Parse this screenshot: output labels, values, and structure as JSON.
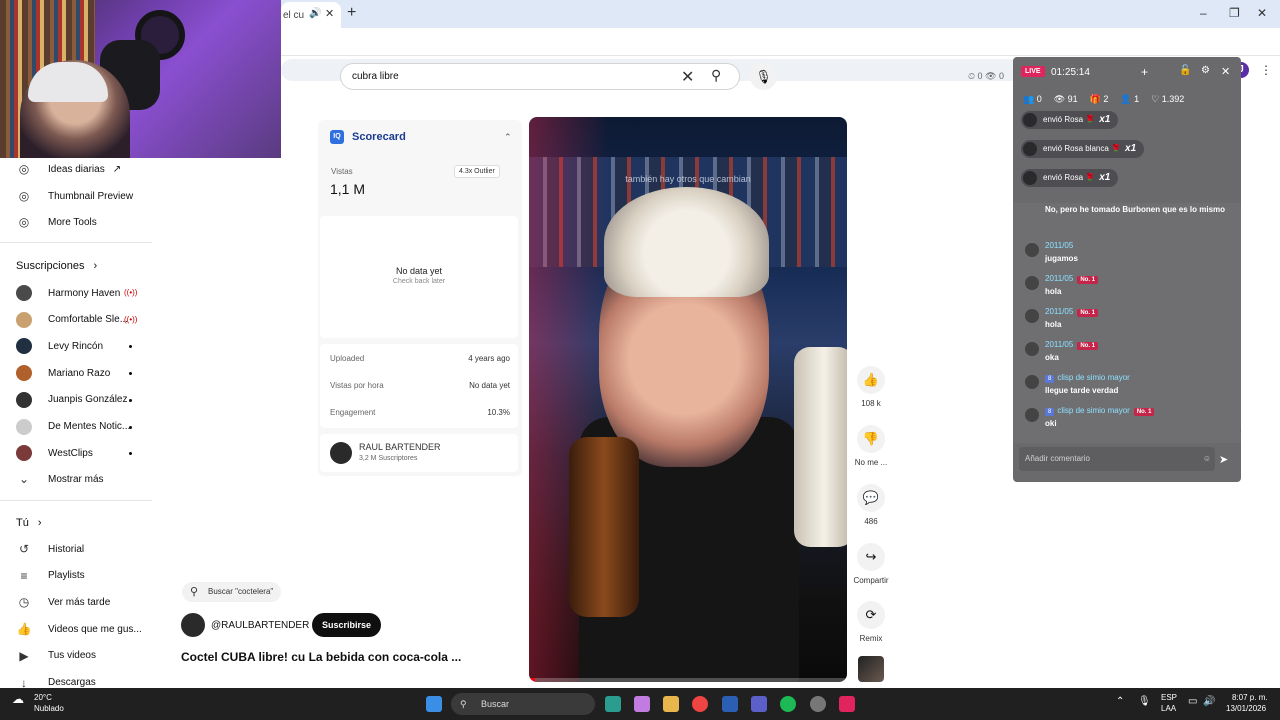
{
  "browser": {
    "tab_title": "el cu",
    "new_tab": "+",
    "win_minimize": "–",
    "win_restore": "❐",
    "win_close": "✕",
    "profile_initial": "J"
  },
  "sidebar": {
    "tools": [
      {
        "label": "Ideas diarias",
        "icon": "external-link-icon"
      },
      {
        "label": "Thumbnail Preview"
      },
      {
        "label": "More Tools"
      }
    ],
    "subscriptions_header": "Suscripciones",
    "subscriptions": [
      {
        "label": "Harmony Haven",
        "status": "live",
        "color": "#4a4a4a"
      },
      {
        "label": "Comfortable Sle...",
        "status": "live",
        "color": "#c9a070"
      },
      {
        "label": "Levy Rincón",
        "status": "new",
        "color": "#203040"
      },
      {
        "label": "Mariano Razo",
        "status": "new",
        "color": "#b0602a"
      },
      {
        "label": "Juanpis González",
        "status": "new",
        "color": "#333333"
      },
      {
        "label": "De Mentes Notic...",
        "status": "new",
        "color": "#cccccc"
      },
      {
        "label": "WestClips",
        "status": "new",
        "color": "#7a3a3a"
      }
    ],
    "show_more": "Mostrar más",
    "you_header": "Tú",
    "you_items": [
      {
        "label": "Historial",
        "icon": "history-icon"
      },
      {
        "label": "Playlists",
        "icon": "playlist-icon"
      },
      {
        "label": "Ver más tarde",
        "icon": "clock-icon"
      },
      {
        "label": "Videos que me gus...",
        "icon": "like-icon"
      },
      {
        "label": "Tus videos",
        "icon": "play-square-icon"
      },
      {
        "label": "Descargas",
        "icon": "download-icon"
      }
    ]
  },
  "search": {
    "value": "cubra libre"
  },
  "scorecard": {
    "title": "Scorecard",
    "views_label": "Vistas",
    "views_value": "1,1 M",
    "outlier": "4.3x Outlier",
    "no_data": "No data yet",
    "check_back": "Check back later",
    "rows": [
      {
        "label": "Uploaded",
        "value": "4 years ago"
      },
      {
        "label": "Vistas por hora",
        "value": "No data yet"
      },
      {
        "label": "Engagement",
        "value": "10.3%"
      }
    ],
    "channel_name": "RAUL BARTENDER",
    "channel_subs": "3,2 M Suscriptores"
  },
  "video": {
    "caption": "también hay otros que cambian",
    "progress": 0.02
  },
  "actions": [
    {
      "name": "like",
      "icon": "👍",
      "label": "108 k"
    },
    {
      "name": "dislike",
      "icon": "👎",
      "label": "No me ..."
    },
    {
      "name": "comments",
      "icon": "💬",
      "label": "486"
    },
    {
      "name": "share",
      "icon": "↪",
      "label": "Compartir"
    },
    {
      "name": "remix",
      "icon": "⟳",
      "label": "Remix"
    }
  ],
  "below_video": {
    "search_chip": "Buscar \"coctelera\"",
    "channel_handle": "@RAULBARTENDER",
    "subscribe": "Suscribirse",
    "title": "Coctel CUBA libre! cu La bebida con coca-cola ..."
  },
  "top_stats": "⏲ 0  👁 0",
  "live_panel": {
    "badge": "LIVE",
    "time": "01:25:14",
    "stats": [
      "0",
      "91",
      "2",
      "1",
      "1.392"
    ],
    "gifts": [
      {
        "text": "envió Rosa",
        "count": "x1"
      },
      {
        "text": "envió Rosa blanca",
        "count": "x1"
      },
      {
        "text": "envió Rosa",
        "count": "x1"
      }
    ],
    "messages": [
      {
        "user": "",
        "text": "No, pero he tomado Burbonen que es lo mismo"
      },
      {
        "user": "2011/05",
        "text": "jugamos",
        "badge": ""
      },
      {
        "user": "2011/05",
        "text": "hola",
        "badge": "No. 1"
      },
      {
        "user": "2011/05",
        "text": "hola",
        "badge": "No. 1"
      },
      {
        "user": "2011/05",
        "text": "oka",
        "badge": "No. 1"
      },
      {
        "user": "clisp de simio mayor",
        "text": "llegue tarde verdad",
        "level": "8"
      },
      {
        "user": "clisp de simio mayor",
        "text": "oki",
        "level": "8",
        "badge": "No. 1"
      }
    ],
    "comment_placeholder": "Añadir comentario"
  },
  "taskbar": {
    "weather_temp": "20°C",
    "weather_desc": "Nublado",
    "search_placeholder": "Buscar",
    "lang": "ESP",
    "lang2": "LAA",
    "time": "8:07 p. m.",
    "date": "13/01/2026"
  }
}
